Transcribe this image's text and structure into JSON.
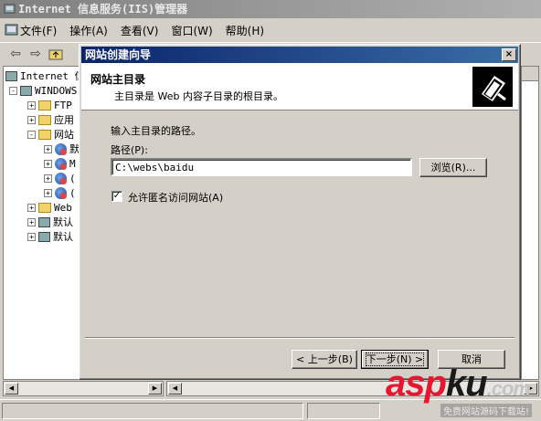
{
  "main_window": {
    "title": "Internet 信息服务(IIS)管理器",
    "menus": [
      "文件(F)",
      "操作(A)",
      "查看(V)",
      "窗口(W)",
      "帮助(H)"
    ]
  },
  "tree": {
    "items": [
      {
        "label": "Internet 信",
        "expander": ""
      },
      {
        "label": "WINDOWS",
        "expander": "-"
      },
      {
        "label": "FTP",
        "expander": "+"
      },
      {
        "label": "应用",
        "expander": "+"
      },
      {
        "label": "网站",
        "expander": "-"
      },
      {
        "label": "默",
        "expander": "+"
      },
      {
        "label": "M",
        "expander": "+"
      },
      {
        "label": "(",
        "expander": "+"
      },
      {
        "label": "(",
        "expander": "+"
      },
      {
        "label": "Web",
        "expander": "+"
      },
      {
        "label": "默认",
        "expander": "+"
      },
      {
        "label": "默认",
        "expander": "+"
      }
    ]
  },
  "wizard": {
    "title": "网站创建向导",
    "close_label": "×",
    "header_title": "网站主目录",
    "header_subtitle": "主目录是 Web 内容子目录的根目录。",
    "prompt": "输入主目录的路径。",
    "path_label": "路径(P):",
    "path_value": "C:\\webs\\baidu",
    "browse_label": "浏览(R)...",
    "anonymous_label": "允许匿名访问网站(A)",
    "anonymous_checked": true,
    "check_glyph": "✓",
    "back_label": "< 上一步(B)",
    "next_label": "下一步(N) >",
    "cancel_label": "取消"
  },
  "watermark": {
    "brand_part1": "asp",
    "brand_part2": "ku",
    "brand_part3": ".com",
    "tagline": "免费网站源码下载站!"
  },
  "colors": {
    "titlebar_active": "#0a246a",
    "face": "#d4d0c8",
    "watermark_red": "#e8172f"
  }
}
